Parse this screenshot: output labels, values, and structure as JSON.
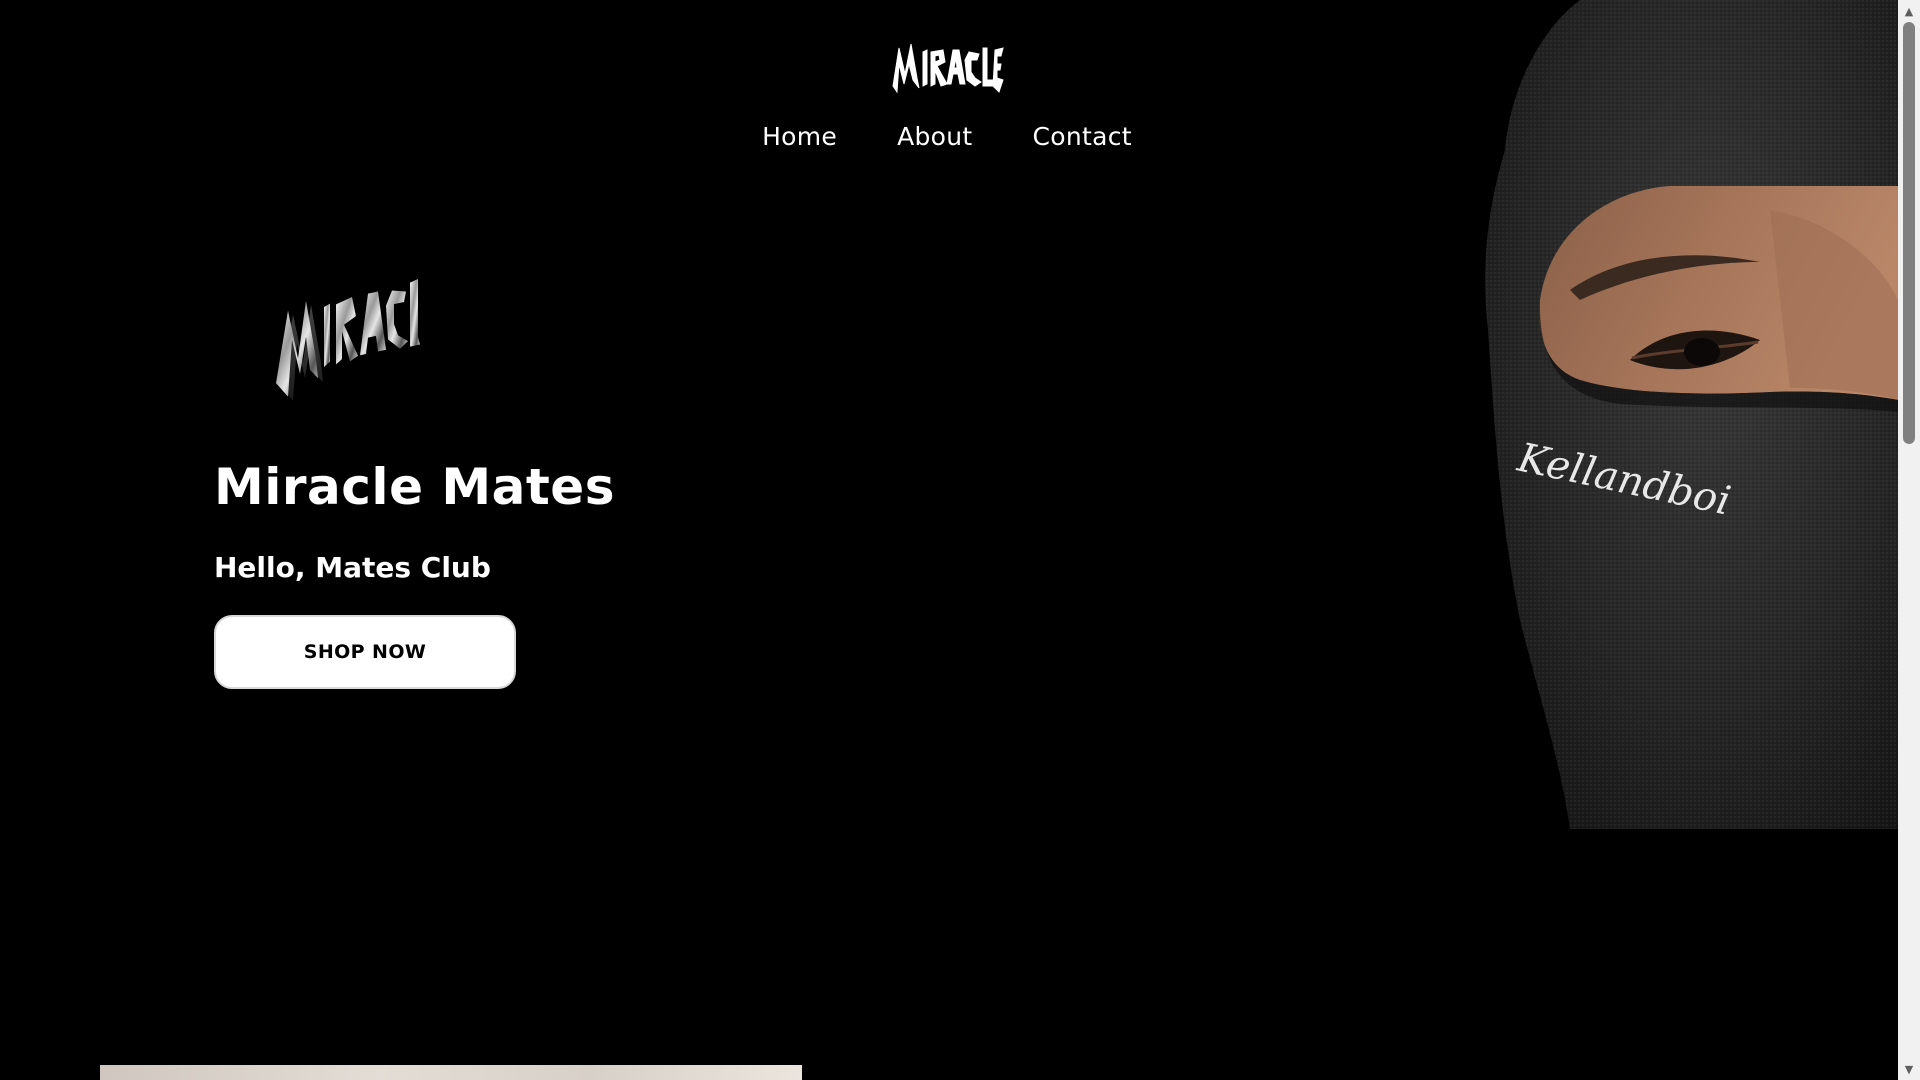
{
  "header": {
    "logo_text": "MIRACLE"
  },
  "nav": {
    "items": [
      {
        "label": "Home"
      },
      {
        "label": "About"
      },
      {
        "label": "Contact"
      }
    ]
  },
  "hero": {
    "logo_text": "MIRACLE",
    "title": "Miracle Mates",
    "subtitle": "Hello, Mates Club",
    "cta_label": "SHOP NOW",
    "image_embroidery_text": "Kellandboi"
  },
  "colors": {
    "background": "#000000",
    "text": "#ffffff",
    "button_bg": "#ffffff",
    "button_text": "#000000"
  },
  "icons": {
    "scroll_up": "scroll-up-arrow-icon",
    "scroll_down": "scroll-down-arrow-icon"
  }
}
